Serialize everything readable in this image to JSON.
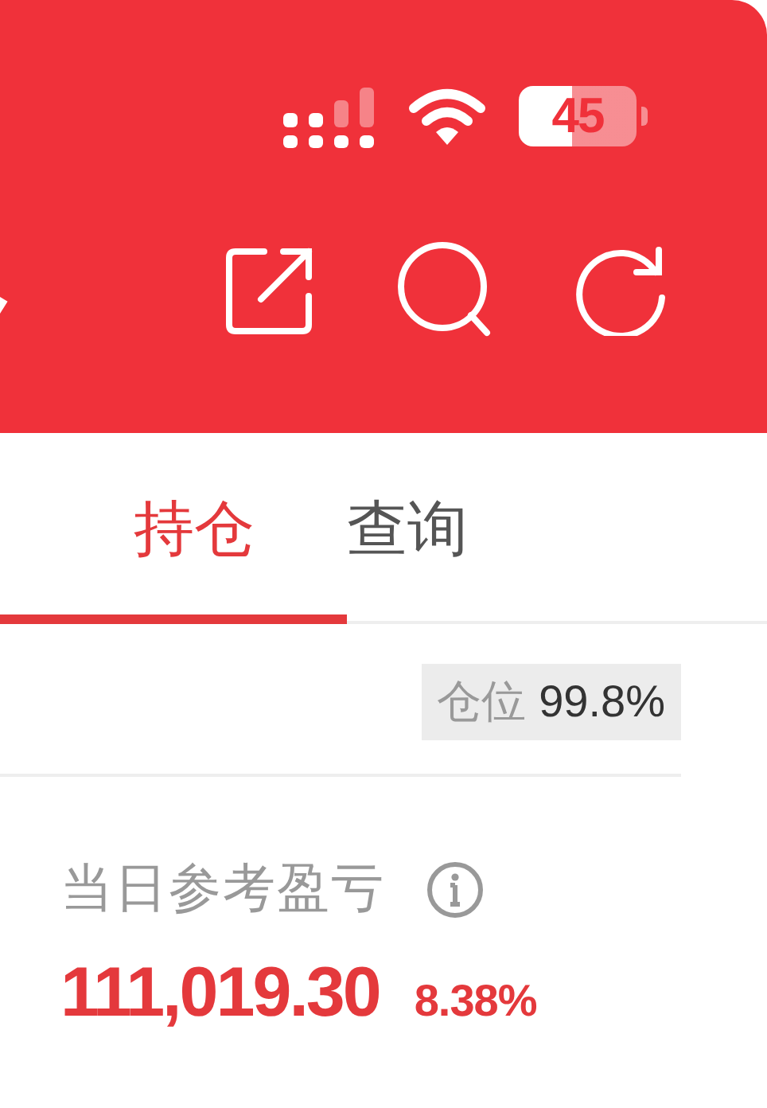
{
  "status_bar": {
    "battery": "45"
  },
  "tabs": [
    {
      "label": "持仓",
      "selected": true
    },
    {
      "label": "查询",
      "selected": false
    }
  ],
  "position": {
    "label": "仓位",
    "value": "99.8%"
  },
  "daily_pnl": {
    "label": "当日参考盈亏",
    "value": "111,019.30",
    "percent": "8.38%"
  }
}
